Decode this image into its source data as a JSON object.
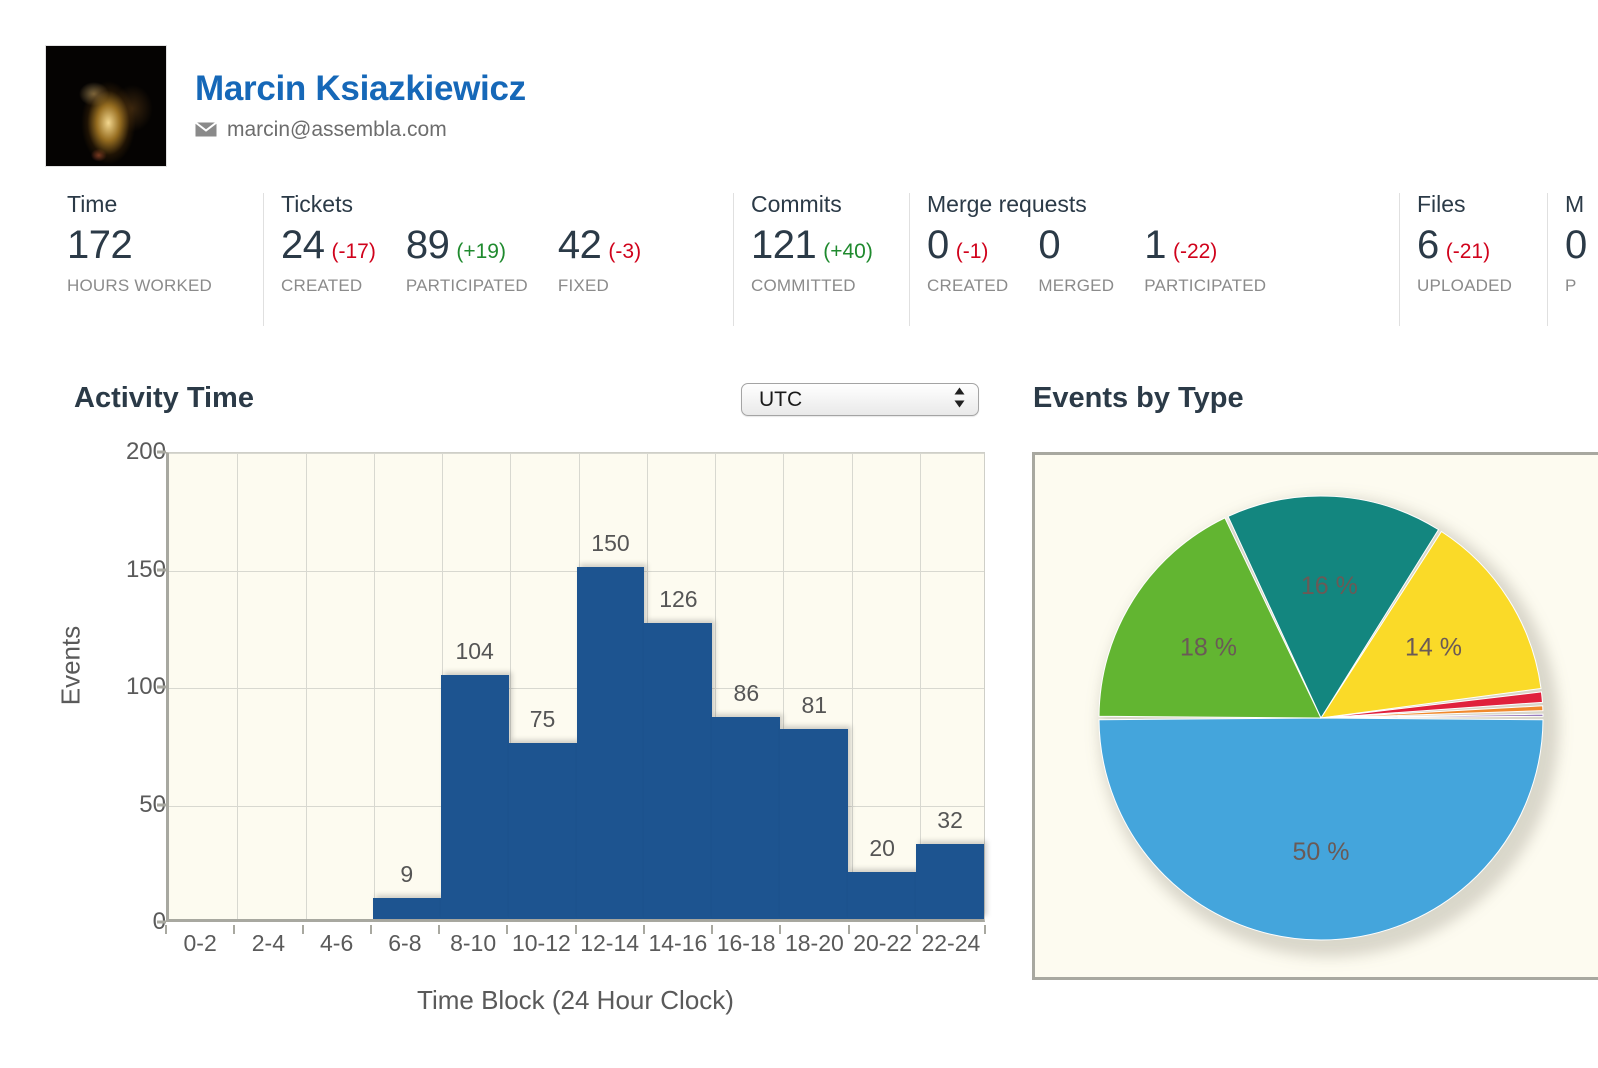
{
  "profile": {
    "name": "Marcin Ksiazkiewicz",
    "email": "marcin@assembla.com",
    "email_icon": "envelope-icon",
    "avatar_alt": "user-avatar"
  },
  "stats": [
    {
      "title": "Time",
      "metrics": [
        {
          "value": "172",
          "delta": "",
          "delta_sign": "none",
          "label": "HOURS WORKED"
        }
      ]
    },
    {
      "title": "Tickets",
      "metrics": [
        {
          "value": "24",
          "delta": "(-17)",
          "delta_sign": "neg",
          "label": "CREATED"
        },
        {
          "value": "89",
          "delta": "(+19)",
          "delta_sign": "pos",
          "label": "PARTICIPATED"
        },
        {
          "value": "42",
          "delta": "(-3)",
          "delta_sign": "neg",
          "label": "FIXED"
        }
      ]
    },
    {
      "title": "Commits",
      "metrics": [
        {
          "value": "121",
          "delta": "(+40)",
          "delta_sign": "pos",
          "label": "COMMITTED"
        }
      ]
    },
    {
      "title": "Merge requests",
      "metrics": [
        {
          "value": "0",
          "delta": "(-1)",
          "delta_sign": "neg",
          "label": "CREATED"
        },
        {
          "value": "0",
          "delta": "",
          "delta_sign": "none",
          "label": "MERGED"
        },
        {
          "value": "1",
          "delta": "(-22)",
          "delta_sign": "neg",
          "label": "PARTICIPATED"
        }
      ]
    },
    {
      "title": "Files",
      "metrics": [
        {
          "value": "6",
          "delta": "(-21)",
          "delta_sign": "neg",
          "label": "UPLOADED"
        }
      ]
    },
    {
      "title": "M",
      "metrics": [
        {
          "value": "0",
          "delta": "",
          "delta_sign": "none",
          "label": "P"
        }
      ]
    }
  ],
  "activity_section": {
    "title": "Activity Time",
    "timezone_selected": "UTC",
    "stepper_icon": "up-down-stepper-icon"
  },
  "events_section": {
    "title": "Events by Type"
  },
  "chart_data": [
    {
      "type": "bar",
      "title": "Activity Time",
      "xlabel": "Time Block (24 Hour Clock)",
      "ylabel": "Events",
      "ylim": [
        0,
        200
      ],
      "yticks": [
        0,
        50,
        100,
        150,
        200
      ],
      "ytick_labels": [
        "0",
        "50",
        "100",
        "150",
        "200"
      ],
      "grid": true,
      "legend": "none",
      "bar_color": "#1d5490",
      "plot_background": "#fdfbf0",
      "categories": [
        "0-2",
        "2-4",
        "4-6",
        "6-8",
        "8-10",
        "10-12",
        "12-14",
        "14-16",
        "16-18",
        "18-20",
        "20-22",
        "22-24"
      ],
      "values": [
        0,
        0,
        0,
        9,
        104,
        75,
        150,
        126,
        86,
        81,
        20,
        32
      ],
      "value_labels": [
        "",
        "",
        "",
        "9",
        "104",
        "75",
        "150",
        "126",
        "86",
        "81",
        "20",
        "32"
      ]
    },
    {
      "type": "pie",
      "title": "Events by Type",
      "plot_background": "#fdfbf0",
      "labels": [
        "50 %",
        "18 %",
        "16 %",
        "14 %",
        "",
        "",
        ""
      ],
      "values": [
        50,
        18,
        16,
        14,
        1.0,
        0.6,
        0.4
      ],
      "colors": [
        "#44a5dc",
        "#62b531",
        "#13867f",
        "#fada28",
        "#e0213c",
        "#f0892d",
        "#8a6ab5"
      ],
      "visible_labels": [
        "50 %",
        "18 %",
        "16 %",
        "14 %"
      ]
    }
  ]
}
